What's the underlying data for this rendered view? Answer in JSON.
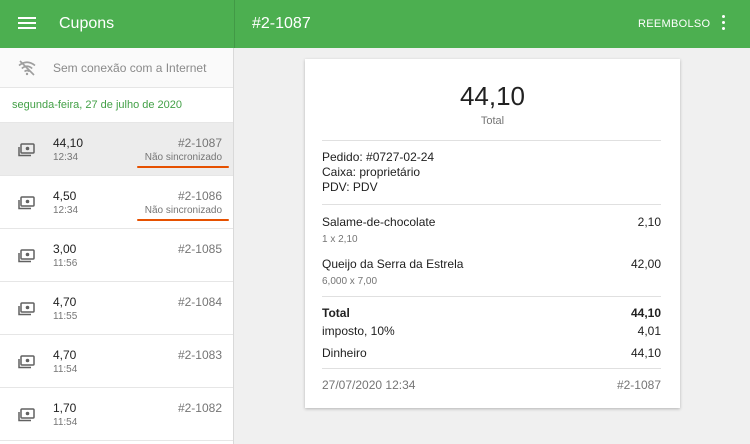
{
  "appbar": {
    "left_title": "Cupons",
    "right_title": "#2-1087",
    "refund_label": "REEMBOLSO"
  },
  "sidebar": {
    "offline_text": "Sem conexão com a Internet",
    "date": "segunda-feira, 27 de julho de 2020",
    "receipts": [
      {
        "amount": "44,10",
        "time": "12:34",
        "number": "#2-1087",
        "status": "Não sincronizado"
      },
      {
        "amount": "4,50",
        "time": "12:34",
        "number": "#2-1086",
        "status": "Não sincronizado"
      },
      {
        "amount": "3,00",
        "time": "11:56",
        "number": "#2-1085",
        "status": ""
      },
      {
        "amount": "4,70",
        "time": "11:55",
        "number": "#2-1084",
        "status": ""
      },
      {
        "amount": "4,70",
        "time": "11:54",
        "number": "#2-1083",
        "status": ""
      },
      {
        "amount": "1,70",
        "time": "11:54",
        "number": "#2-1082",
        "status": ""
      }
    ]
  },
  "receipt": {
    "total_amount": "44,10",
    "total_label": "Total",
    "order": "Pedido: #0727-02-24",
    "cashier": "Caixa: proprietário",
    "pos": "PDV: PDV",
    "items": [
      {
        "name": "Salame-de-chocolate",
        "detail": "1 x 2,10",
        "price": "2,10"
      },
      {
        "name": "Queijo da Serra da Estrela",
        "detail": "6,000 x 7,00",
        "price": "42,00"
      }
    ],
    "summary_total_label": "Total",
    "summary_total_value": "44,10",
    "tax_label": "imposto, 10%",
    "tax_value": "4,01",
    "payment_label": "Dinheiro",
    "payment_value": "44,10",
    "footer_datetime": "27/07/2020 12:34",
    "footer_number": "#2-1087"
  },
  "colors": {
    "appbar": "#4caf50",
    "date_text": "#43a047",
    "unsynced_underline": "#e65100"
  },
  "icons": {
    "menu": "menu-icon",
    "more": "more-vert-icon",
    "offline": "wifi-off-icon",
    "receipt": "cash-icon"
  }
}
